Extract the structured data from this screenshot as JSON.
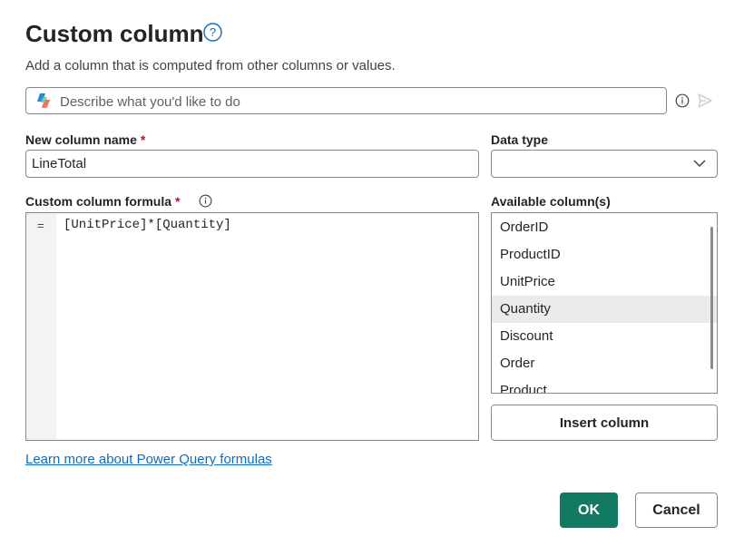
{
  "dialog": {
    "title": "Custom column",
    "subtitle": "Add a column that is computed from other columns or values."
  },
  "copilot": {
    "placeholder": "Describe what you'd like to do",
    "icons": [
      "copilot-logo-icon",
      "info-icon",
      "send-icon"
    ]
  },
  "fields": {
    "name_label": "New column name",
    "name_value": "LineTotal",
    "required_marker": "*",
    "type_label": "Data type",
    "type_value": "",
    "formula_label": "Custom column formula",
    "formula_prefix": "=",
    "formula_value": "[UnitPrice]*[Quantity]",
    "available_label": "Available column(s)"
  },
  "available_columns": [
    "OrderID",
    "ProductID",
    "UnitPrice",
    "Quantity",
    "Discount",
    "Order",
    "Product"
  ],
  "selected_column": "Quantity",
  "actions": {
    "insert": "Insert column",
    "learn_more": "Learn more about Power Query formulas",
    "ok": "OK",
    "cancel": "Cancel"
  },
  "colors": {
    "primary": "#127a62",
    "link": "#0f6cbd",
    "required": "#c50f1f",
    "help_icon": "#0f6cbd"
  }
}
